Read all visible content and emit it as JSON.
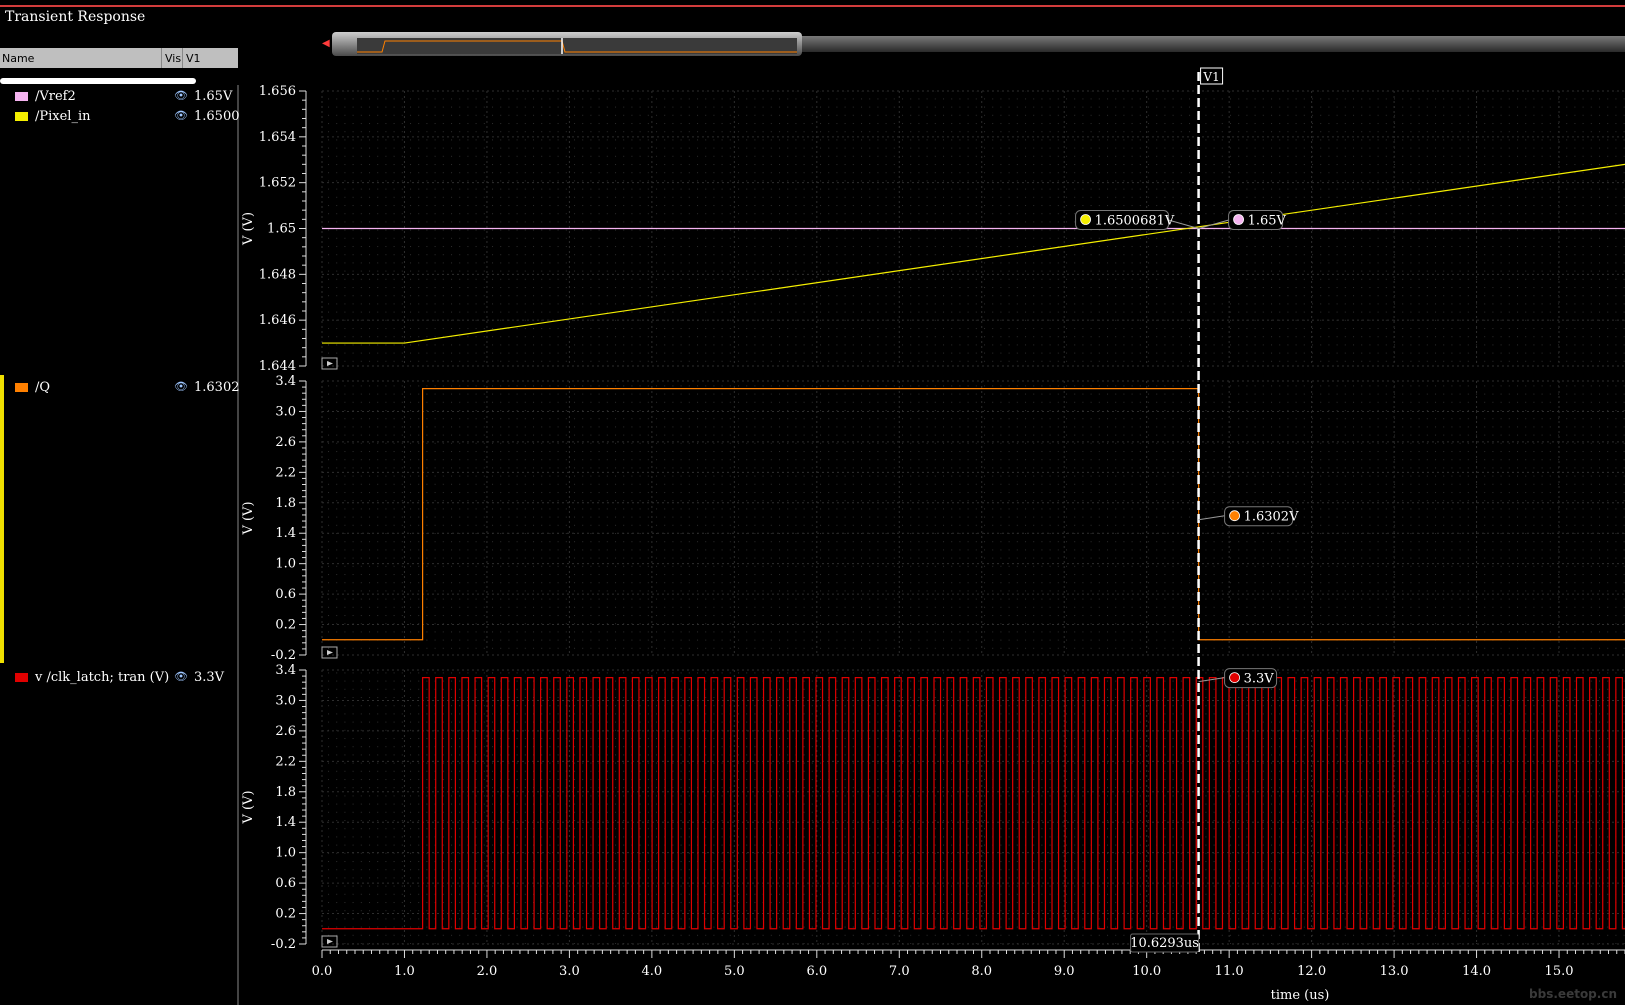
{
  "window": {
    "title": "Transient Response"
  },
  "legend": {
    "headers": {
      "name": "Name",
      "vis": "Vis",
      "v1": "V1"
    },
    "rows": [
      {
        "name": "/Vref2",
        "value": "1.65V",
        "color": "#f5b3f0",
        "eye": "eye-icon"
      },
      {
        "name": "/Pixel_in",
        "value": "1.6500",
        "color": "#f5ef00",
        "eye": "eye-icon"
      },
      {
        "name": "/Q",
        "value": "1.6302",
        "color": "#ff8000",
        "eye": "eye-icon"
      },
      {
        "name": "v /clk_latch; tran (V)",
        "value": "3.3V",
        "color": "#e00000",
        "eye": "eye-icon"
      }
    ]
  },
  "cursor": {
    "label": "V1",
    "time_label": "10.6293us",
    "time_us": 10.6293
  },
  "markers": {
    "pixel_in": "1.6500681V",
    "vref2": "1.65V",
    "q": "1.6302V",
    "clk": "3.3V"
  },
  "watermark": "bbs.eetop.cn",
  "chart_data": [
    {
      "type": "line",
      "ylabel": "V (V)",
      "ylim": [
        1.644,
        1.656
      ],
      "yticks": [
        "1.656",
        "1.654",
        "1.652",
        "1.65",
        "1.648",
        "1.646",
        "1.644"
      ],
      "series": [
        {
          "name": "/Vref2",
          "color": "#f5b3f0",
          "x": [
            0,
            15.8
          ],
          "y": [
            1.65,
            1.65
          ]
        },
        {
          "name": "/Pixel_in",
          "color": "#f5ef00",
          "x": [
            0,
            1.0,
            15.8
          ],
          "y": [
            1.645,
            1.645,
            1.6528
          ]
        }
      ]
    },
    {
      "type": "line",
      "ylabel": "V (V)",
      "ylim": [
        -0.2,
        3.4
      ],
      "yticks": [
        "3.4",
        "3.0",
        "2.6",
        "2.2",
        "1.8",
        "1.4",
        "1.0",
        "0.6",
        "0.2",
        "-0.2"
      ],
      "series": [
        {
          "name": "/Q",
          "color": "#ff8000",
          "x": [
            0,
            1.22,
            1.22,
            10.63,
            10.63,
            15.8
          ],
          "y": [
            0,
            0,
            3.3,
            3.3,
            0,
            0
          ]
        }
      ]
    },
    {
      "type": "line",
      "ylabel": "V (V)",
      "ylim": [
        -0.2,
        3.4
      ],
      "yticks": [
        "3.4",
        "3.0",
        "2.6",
        "2.2",
        "1.8",
        "1.4",
        "1.0",
        "0.6",
        "0.2",
        "-0.2"
      ],
      "xlabel": "time (us)",
      "xlim": [
        0,
        15.8
      ],
      "xticks": [
        "0.0",
        "1.0",
        "2.0",
        "3.0",
        "4.0",
        "5.0",
        "6.0",
        "7.0",
        "8.0",
        "9.0",
        "10.0",
        "11.0",
        "12.0",
        "13.0",
        "14.0",
        "15.0"
      ],
      "series": [
        {
          "name": "v /clk_latch; tran (V)",
          "color": "#e00000",
          "clock": {
            "start": 1.22,
            "period": 0.159,
            "duty": 0.5,
            "high": 3.3,
            "low": 0
          }
        }
      ]
    }
  ]
}
